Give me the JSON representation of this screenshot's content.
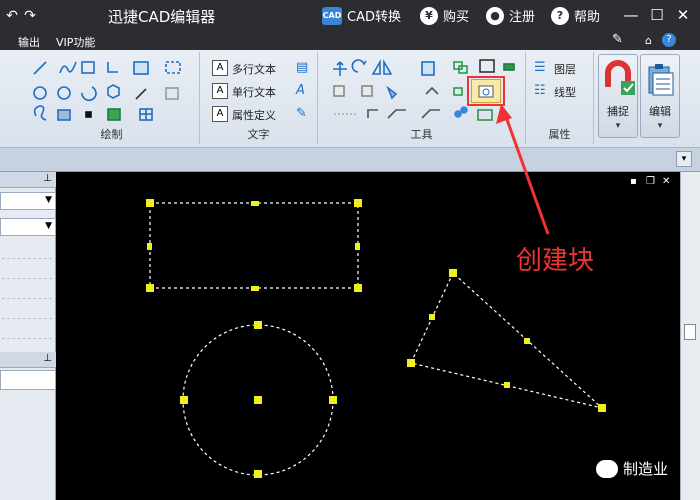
{
  "window": {
    "title": "迅捷CAD编辑器",
    "menu_items": [
      {
        "label": "CAD转换",
        "icon": "cad-convert-icon",
        "badge": "CAD"
      },
      {
        "label": "购买",
        "icon": "yen-icon",
        "badge": "¥"
      },
      {
        "label": "注册",
        "icon": "user-icon",
        "badge": "●"
      },
      {
        "label": "帮助",
        "icon": "help-icon",
        "badge": "?"
      }
    ]
  },
  "menustrip": {
    "items": [
      "输出",
      "VIP功能"
    ]
  },
  "ribbon": {
    "groups": [
      {
        "label": "绘制"
      },
      {
        "label": "文字",
        "buttons": [
          "多行文本",
          "单行文本",
          "属性定义"
        ]
      },
      {
        "label": "工具"
      },
      {
        "label": "属性",
        "buttons": [
          "图层",
          "线型"
        ]
      }
    ],
    "big_buttons": [
      {
        "label": "捕捉",
        "icon": "magnet-icon"
      },
      {
        "label": "编辑",
        "icon": "clipboard-icon"
      }
    ]
  },
  "annotation": {
    "text": "创建块",
    "color": "#e33333"
  },
  "watermark": {
    "text": "制造业"
  },
  "colors": {
    "grip": "#f0f020",
    "dashed": "#ffffff",
    "canvas": "#000000",
    "highlight": "#e33333"
  }
}
